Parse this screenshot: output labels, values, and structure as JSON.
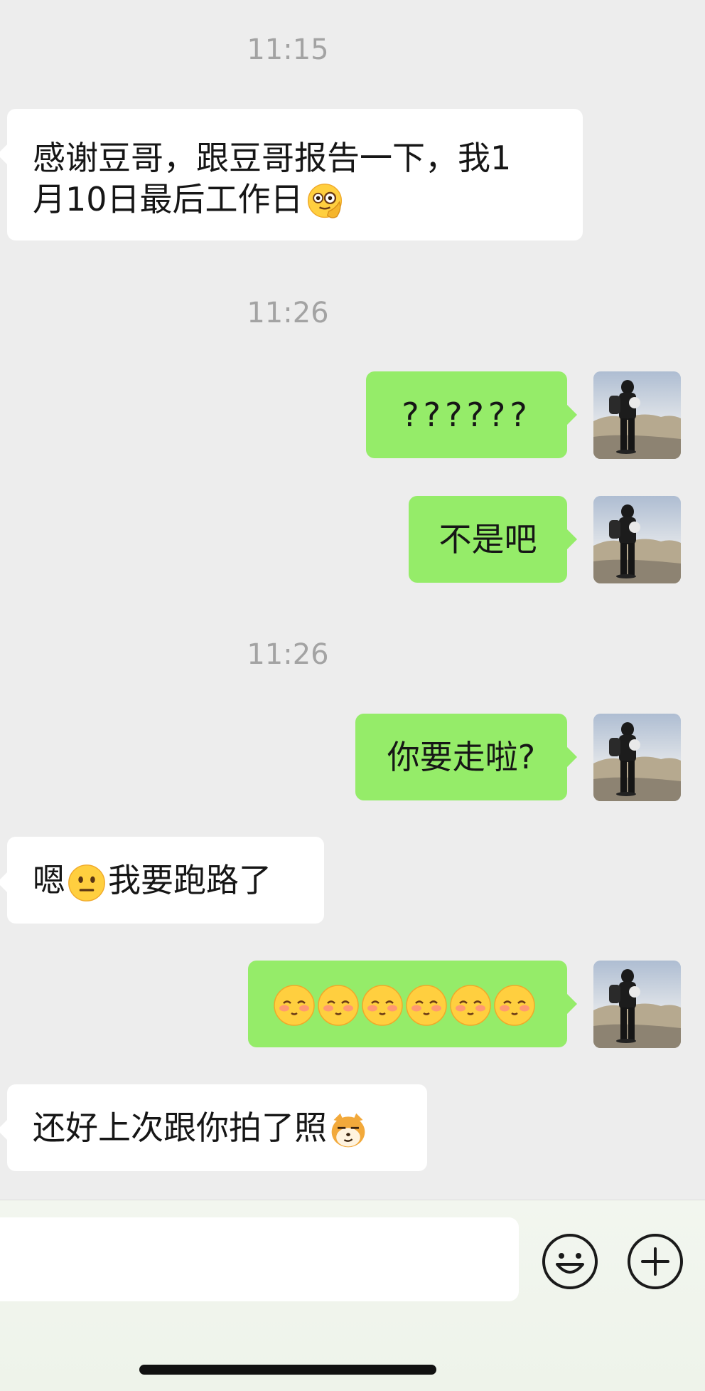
{
  "chat": {
    "timestamps": [
      "11:15",
      "11:26",
      "11:26"
    ],
    "messages": {
      "m1_line1": "感谢豆哥，跟豆哥报告一下，我1",
      "m1_line2": "月10日最后工作日",
      "m2": "??????",
      "m3": "不是吧",
      "m4": "你要走啦?",
      "m5_a": "嗯",
      "m5_b": "我要跑路了",
      "m7": "还好上次跟你拍了照"
    },
    "emoji": {
      "m1": "monocle-pointing-emoji",
      "m5": "neutral-face-emoji",
      "m6": [
        "blushing-face-emoji",
        "blushing-face-emoji",
        "blushing-face-emoji",
        "blushing-face-emoji",
        "blushing-face-emoji",
        "blushing-face-emoji"
      ],
      "m7": "shiba-dog-smirk-emoji"
    }
  },
  "input_bar": {
    "emoji_button_icon": "smiley-icon",
    "more_button_icon": "plus-circle-icon"
  },
  "colors": {
    "background": "#ededed",
    "incoming_bubble": "#ffffff",
    "outgoing_bubble": "#95ec69",
    "timestamp_text": "#a3a3a3"
  }
}
